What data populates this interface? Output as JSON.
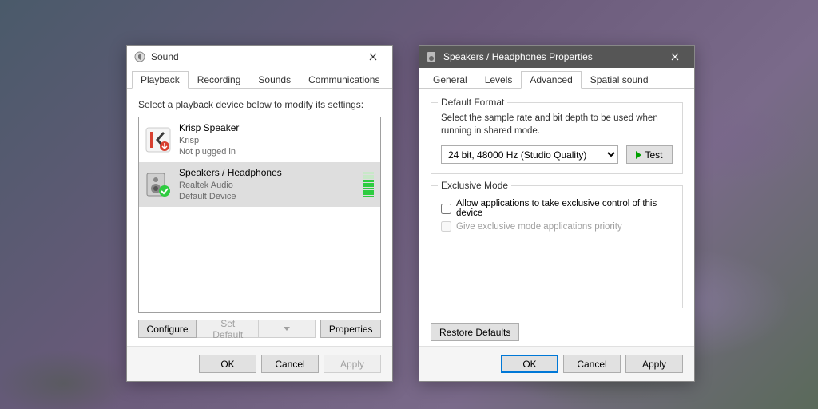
{
  "sound_window": {
    "title": "Sound",
    "tabs": [
      "Playback",
      "Recording",
      "Sounds",
      "Communications"
    ],
    "active_tab": 0,
    "instruction": "Select a playback device below to modify its settings:",
    "devices": [
      {
        "name": "Krisp Speaker",
        "line2": "Krisp",
        "status": "Not plugged in",
        "selected": false,
        "icon": "krisp-k"
      },
      {
        "name": "Speakers / Headphones",
        "line2": "Realtek Audio",
        "status": "Default Device",
        "selected": true,
        "icon": "speaker-check"
      }
    ],
    "buttons": {
      "configure": "Configure",
      "set_default": "Set Default",
      "properties": "Properties",
      "ok": "OK",
      "cancel": "Cancel",
      "apply": "Apply"
    }
  },
  "props_window": {
    "title": "Speakers / Headphones Properties",
    "tabs": [
      "General",
      "Levels",
      "Advanced",
      "Spatial sound"
    ],
    "active_tab": 2,
    "default_format": {
      "legend": "Default Format",
      "description": "Select the sample rate and bit depth to be used when running in shared mode.",
      "selected": "24 bit, 48000 Hz (Studio Quality)",
      "test_label": "Test"
    },
    "exclusive_mode": {
      "legend": "Exclusive Mode",
      "opt1": "Allow applications to take exclusive control of this device",
      "opt1_checked": false,
      "opt2": "Give exclusive mode applications priority",
      "opt2_checked": false,
      "opt2_disabled": true
    },
    "restore_defaults": "Restore Defaults",
    "buttons": {
      "ok": "OK",
      "cancel": "Cancel",
      "apply": "Apply"
    }
  }
}
